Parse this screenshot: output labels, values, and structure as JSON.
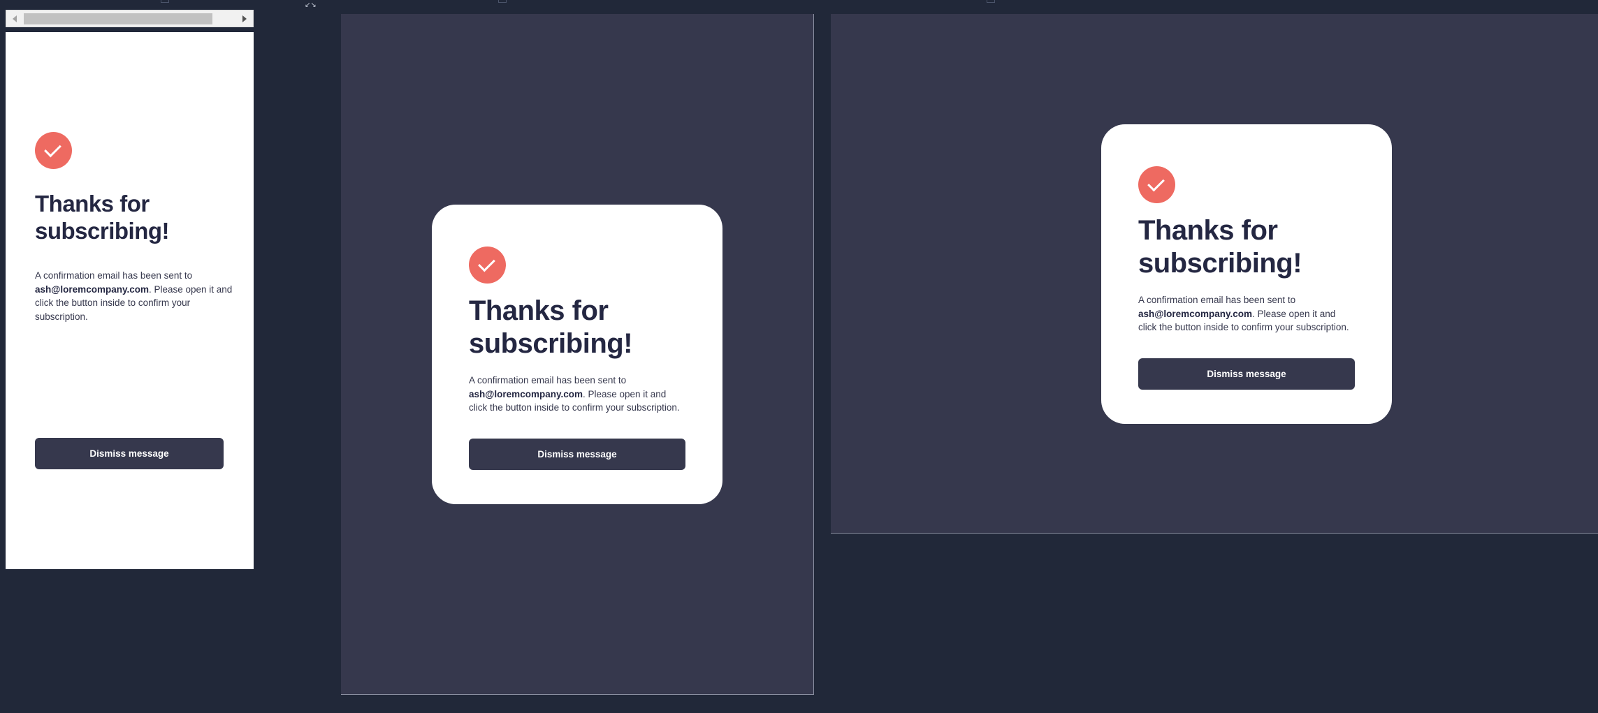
{
  "message": {
    "title": "Thanks for subscribing!",
    "intro": "A confirmation email has been sent to",
    "email": "ash@loremcompany.com",
    "outro": ". Please open it and click the button inside to confirm your subscription.",
    "dismiss_label": "Dismiss message"
  },
  "colors": {
    "page_background": "#212839",
    "overlay": "#36384d",
    "card": "#ffffff",
    "accent": "#ee6a61",
    "heading": "#242742",
    "button": "#36384d"
  },
  "icons": {
    "success": "check-circle-icon",
    "scroll_left": "arrow-left-icon",
    "scroll_right": "arrow-right-icon",
    "expand": "expand-icon"
  }
}
